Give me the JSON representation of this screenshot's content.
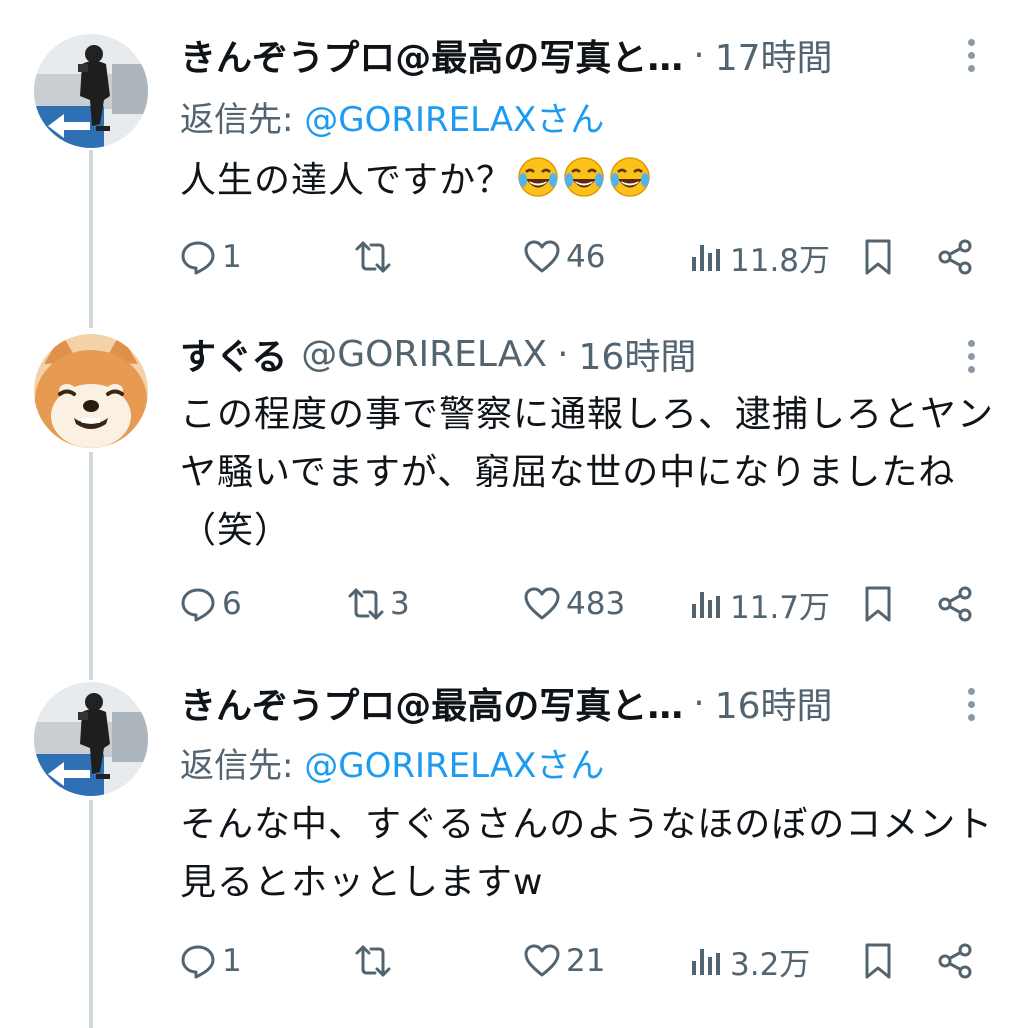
{
  "tweets": [
    {
      "author_name": "きんぞうプロ@最高の写真と…",
      "handle": "",
      "time": "17時間",
      "reply_prefix": "返信先: ",
      "reply_mention": "@GORIRELAXさん",
      "body": "人生の達人ですか？",
      "emoji": [
        "face-with-tears-of-joy",
        "face-with-tears-of-joy",
        "face-with-tears-of-joy"
      ],
      "replies": "1",
      "retweets": "",
      "likes": "46",
      "views": "11.8万",
      "avatar": "photographer-avatar"
    },
    {
      "author_name": "すぐる",
      "handle": "@GORIRELAX",
      "time": "16時間",
      "reply_prefix": "",
      "reply_mention": "",
      "body": "この程度の事で警察に通報しろ、逮捕しろとヤンヤ騒いでますが、窮屈な世の中になりましたね（笑）",
      "emoji": [],
      "replies": "6",
      "retweets": "3",
      "likes": "483",
      "views": "11.7万",
      "avatar": "shiba-dog-avatar"
    },
    {
      "author_name": "きんぞうプロ@最高の写真と…",
      "handle": "",
      "time": "16時間",
      "reply_prefix": "返信先: ",
      "reply_mention": "@GORIRELAXさん",
      "body": "そんな中、すぐるさんのようなほのぼのコメント見るとホッとしますw",
      "emoji": [],
      "replies": "1",
      "retweets": "",
      "likes": "21",
      "views": "3.2万",
      "avatar": "photographer-avatar"
    }
  ],
  "colors": {
    "text": "#0f1419",
    "muted": "#536471",
    "link": "#1d9bf0",
    "thread_line": "#cfd9de"
  }
}
